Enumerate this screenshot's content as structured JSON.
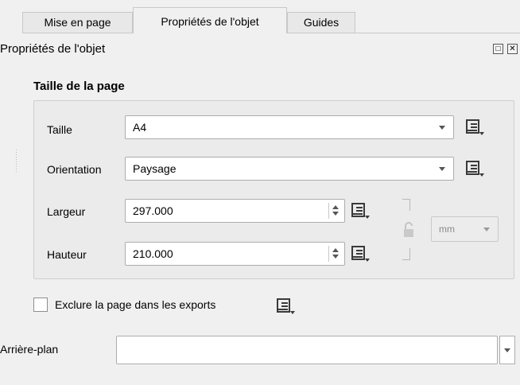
{
  "tabs": [
    {
      "label": "Mise en page",
      "active": false
    },
    {
      "label": "Propriétés de l'objet",
      "active": true
    },
    {
      "label": "Guides",
      "active": false
    }
  ],
  "panel": {
    "title": "Propriétés de l'objet",
    "undock_icon": "float-icon",
    "close_icon": "close-icon"
  },
  "page_size": {
    "group_title": "Taille de la page",
    "size": {
      "label": "Taille",
      "value": "A4"
    },
    "orientation": {
      "label": "Orientation",
      "value": "Paysage"
    },
    "width": {
      "label": "Largeur",
      "value": "297.000"
    },
    "height": {
      "label": "Hauteur",
      "value": "210.000"
    },
    "unit": {
      "value": "mm"
    },
    "ratio_lock_icon": "lock-icon"
  },
  "exclude": {
    "label": "Exclure la page dans les exports",
    "checked": false
  },
  "background": {
    "label": "Arrière-plan",
    "value": ""
  },
  "colors": {
    "border": "#adadad",
    "panel_bg": "#f0f0f0",
    "group_bg": "#ebebeb"
  }
}
